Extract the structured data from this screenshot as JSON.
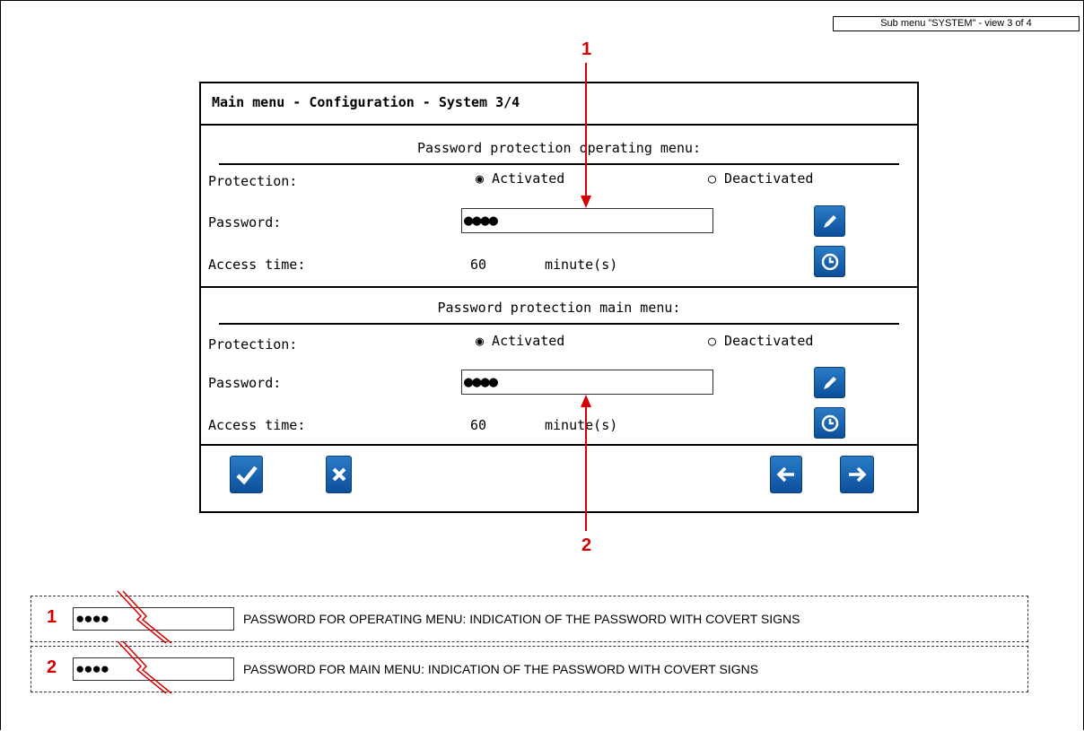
{
  "view_tag": "Sub menu \"SYSTEM\" - view 3 of 4",
  "panel_title": "Main menu - Configuration - System 3/4",
  "sections": [
    {
      "heading": "Password protection operating menu:",
      "protection_label": "Protection:",
      "option_activated": "◉ Activated",
      "option_deactivated": "○ Deactivated",
      "selected": "Activated",
      "password_label": "Password:",
      "password_value": "●●●●",
      "access_label": "Access time:",
      "access_value": "60",
      "access_unit": "minute(s)"
    },
    {
      "heading": "Password protection main menu:",
      "protection_label": "Protection:",
      "option_activated": "◉ Activated",
      "option_deactivated": "○ Deactivated",
      "selected": "Activated",
      "password_label": "Password:",
      "password_value": "●●●●",
      "access_label": "Access time:",
      "access_value": "60",
      "access_unit": "minute(s)"
    }
  ],
  "icons": {
    "edit": "pencil-icon",
    "time": "clock-icon",
    "confirm": "checkmark-icon",
    "cancel": "close-icon",
    "prev": "arrow-left-icon",
    "next": "arrow-right-icon"
  },
  "colors": {
    "button_blue": "#1a66b3",
    "annotation_red": "#d40000"
  },
  "callouts": {
    "one": "1",
    "two": "2"
  },
  "legend": [
    {
      "number": "1",
      "field_value": "●●●●",
      "text": "PASSWORD FOR OPERATING MENU: INDICATION OF THE PASSWORD WITH COVERT SIGNS"
    },
    {
      "number": "2",
      "field_value": "●●●●",
      "text": "PASSWORD FOR MAIN MENU: INDICATION OF THE PASSWORD WITH COVERT SIGNS"
    }
  ]
}
